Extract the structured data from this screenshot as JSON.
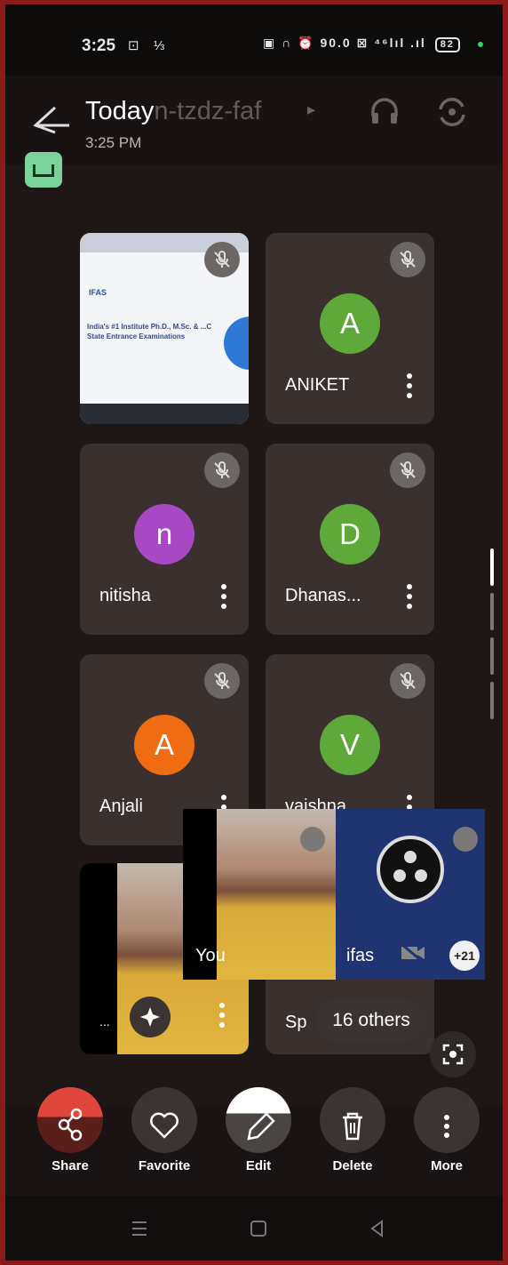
{
  "status_bar": {
    "time": "3:25",
    "left_icons": "⊡ ⅓",
    "network": "▣ ∩ ⏰ 90.0 ⊠ ⁴⁶lıl .ıl",
    "battery": "82"
  },
  "header": {
    "title_day": "Today",
    "title_code": "n-tzdz-faf",
    "subtitle": "3:25 PM"
  },
  "participants": [
    {
      "name": "",
      "type": "screen-share"
    },
    {
      "name": "ANIKET",
      "initial": "A",
      "color": "#5fa83a"
    },
    {
      "name": "nitisha",
      "initial": "n",
      "color": "#a848c4"
    },
    {
      "name": "Dhanas...",
      "initial": "D",
      "color": "#5fa83a"
    },
    {
      "name": "Anjali",
      "initial": "A",
      "color": "#f06c12"
    },
    {
      "name": "vaishna",
      "initial": "V",
      "color": "#5fa83a"
    }
  ],
  "screen_share": {
    "logo": "IFAS",
    "text": "India's #1 Institute Ph.D., M.Sc. & ...C State Entrance Examinations"
  },
  "video_tiles": {
    "self_dots": "...",
    "partial_label": "Sp"
  },
  "pip": {
    "you_label": "You",
    "ifas_label": "ifas",
    "more_count": "+21"
  },
  "others_pill": "16 others",
  "actions": [
    {
      "label": "Share",
      "icon": "share-icon"
    },
    {
      "label": "Favorite",
      "icon": "heart-icon"
    },
    {
      "label": "Edit",
      "icon": "pencil-icon"
    },
    {
      "label": "Delete",
      "icon": "trash-icon"
    },
    {
      "label": "More",
      "icon": "more-icon"
    }
  ],
  "colors": {
    "share": "#e0463c",
    "background": "#1e1716",
    "tile": "#3a302e"
  }
}
